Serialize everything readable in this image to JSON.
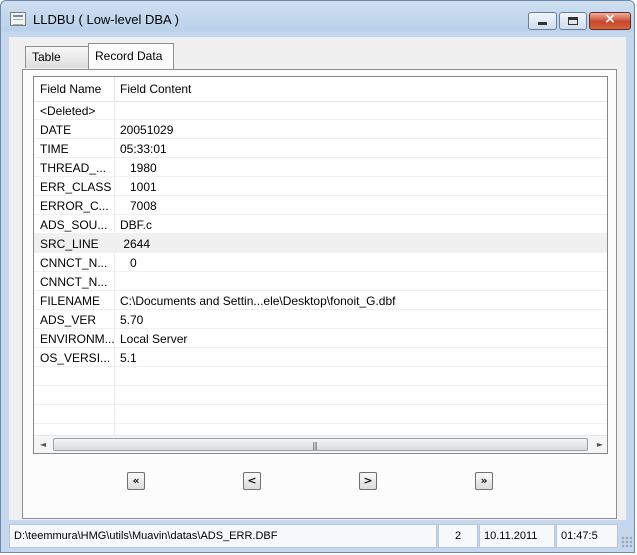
{
  "window": {
    "title": "LLDBU ( Low-level DBA )",
    "controls": {
      "minimize": "minimize",
      "maximize": "maximize",
      "close": "×"
    }
  },
  "tabs": [
    {
      "label": "Table Info",
      "active": false
    },
    {
      "label": "Record Data",
      "active": true
    }
  ],
  "grid": {
    "columns": [
      "Field Name",
      "Field Content"
    ],
    "rows": [
      {
        "name": "<Deleted>",
        "value": ""
      },
      {
        "name": "DATE",
        "value": "20051029"
      },
      {
        "name": "TIME",
        "value": "05:33:01"
      },
      {
        "name": "THREAD_...",
        "value": "   1980"
      },
      {
        "name": "ERR_CLASS",
        "value": "   1001"
      },
      {
        "name": "ERROR_C...",
        "value": "   7008"
      },
      {
        "name": "ADS_SOU...",
        "value": "DBF.c"
      },
      {
        "name": "SRC_LINE",
        "value": " 2644"
      },
      {
        "name": "CNNCT_N...",
        "value": "   0"
      },
      {
        "name": "CNNCT_N...",
        "value": ""
      },
      {
        "name": "FILENAME",
        "value": "C:\\Documents and Settin...ele\\Desktop\\fonoit_G.dbf"
      },
      {
        "name": "ADS_VER",
        "value": "5.70"
      },
      {
        "name": "ENVIRONM...",
        "value": "Local Server"
      },
      {
        "name": "OS_VERSI...",
        "value": "5.1"
      },
      {
        "name": "",
        "value": ""
      },
      {
        "name": "",
        "value": ""
      },
      {
        "name": "",
        "value": ""
      },
      {
        "name": "",
        "value": ""
      }
    ],
    "selected_row": 7,
    "scroll_arrows": {
      "left": "◄",
      "right": "►"
    },
    "thumb_grip": "|||"
  },
  "navigation": {
    "first": "«",
    "prev": "<",
    "next": ">",
    "last": "»"
  },
  "status": {
    "path": "D:\\teemmura\\HMG\\utils\\Muavin\\datas\\ADS_ERR.DBF",
    "record": "2",
    "date": "10.11.2011",
    "time": "01:47:5"
  }
}
